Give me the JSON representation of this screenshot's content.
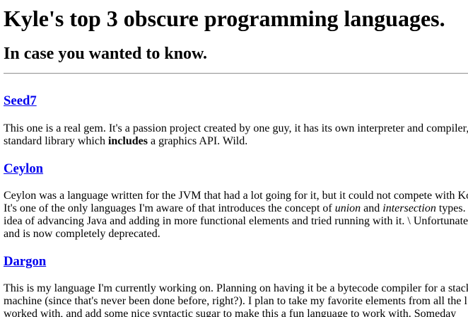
{
  "header": {
    "title": "Kyle's top 3 obscure programming languages.",
    "subtitle": "In case you wanted to know."
  },
  "sections": [
    {
      "title": "Seed7",
      "lines": [
        {
          "parts": [
            {
              "t": "This one is a real gem. It's a passion project created by one guy, it has its own interpreter and compiler,"
            }
          ]
        },
        {
          "parts": [
            {
              "t": "standard library which "
            },
            {
              "t": "includes",
              "b": true
            },
            {
              "t": " a graphics API. Wild."
            }
          ]
        }
      ]
    },
    {
      "title": "Ceylon",
      "lines": [
        {
          "parts": [
            {
              "t": "Ceylon was a language written for the JVM that had a lot going for it, but it could not compete with Ko"
            }
          ]
        },
        {
          "parts": [
            {
              "t": "It's one of the only languages I'm aware of that introduces the concept of "
            },
            {
              "t": "union",
              "i": true
            },
            {
              "t": " and "
            },
            {
              "t": "intersection",
              "i": true
            },
            {
              "t": " types."
            }
          ]
        },
        {
          "parts": [
            {
              "t": "idea of advancing Java and adding in more functional elements and tried running with it. \\ Unfortunate"
            }
          ]
        },
        {
          "parts": [
            {
              "t": "and is now completely deprecated."
            }
          ]
        }
      ]
    },
    {
      "title": "Dargon",
      "lines": [
        {
          "parts": [
            {
              "t": "This is my language I'm currently working on. Planning on having it be a bytecode compiler for a stack"
            }
          ]
        },
        {
          "parts": [
            {
              "t": "machine (since that's never been done before, right?). I plan to take my favorite elements from all the l"
            }
          ]
        },
        {
          "parts": [
            {
              "t": "worked with, and add some nice syntactic sugar to make this a fun language to work with. Someday"
            }
          ]
        }
      ]
    }
  ]
}
